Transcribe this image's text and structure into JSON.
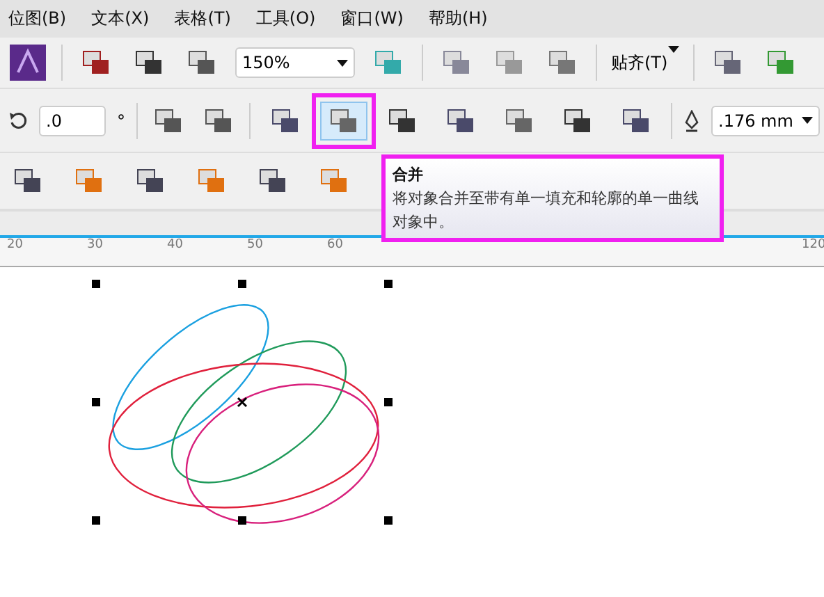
{
  "menu": [
    "位图(B)",
    "文本(X)",
    "表格(T)",
    "工具(O)",
    "窗口(W)",
    "帮助(H)"
  ],
  "standard_toolbar": {
    "zoom": "150%",
    "snap": "贴齐(T)"
  },
  "property_bar": {
    "rotation": ".0",
    "degree_sign": "°",
    "outline_width": ".176 mm",
    "shaping_buttons": [
      {
        "selected": false
      },
      {
        "selected": true
      },
      {
        "selected": false
      },
      {
        "selected": false
      },
      {
        "selected": false
      },
      {
        "selected": false
      },
      {
        "selected": false
      }
    ]
  },
  "tooltip": {
    "title": "合并",
    "text": "将对象合并至带有单一填充和轮廓的单一曲线对象中。"
  },
  "ruler": {
    "labels": [
      "20",
      "30",
      "40",
      "50",
      "60",
      "120"
    ]
  },
  "canvas": {
    "shapes": [
      {
        "color": "#1aa0e0"
      },
      {
        "color": "#1f9a5a"
      },
      {
        "color": "#e0203c"
      },
      {
        "color": "#d8207c"
      }
    ]
  }
}
